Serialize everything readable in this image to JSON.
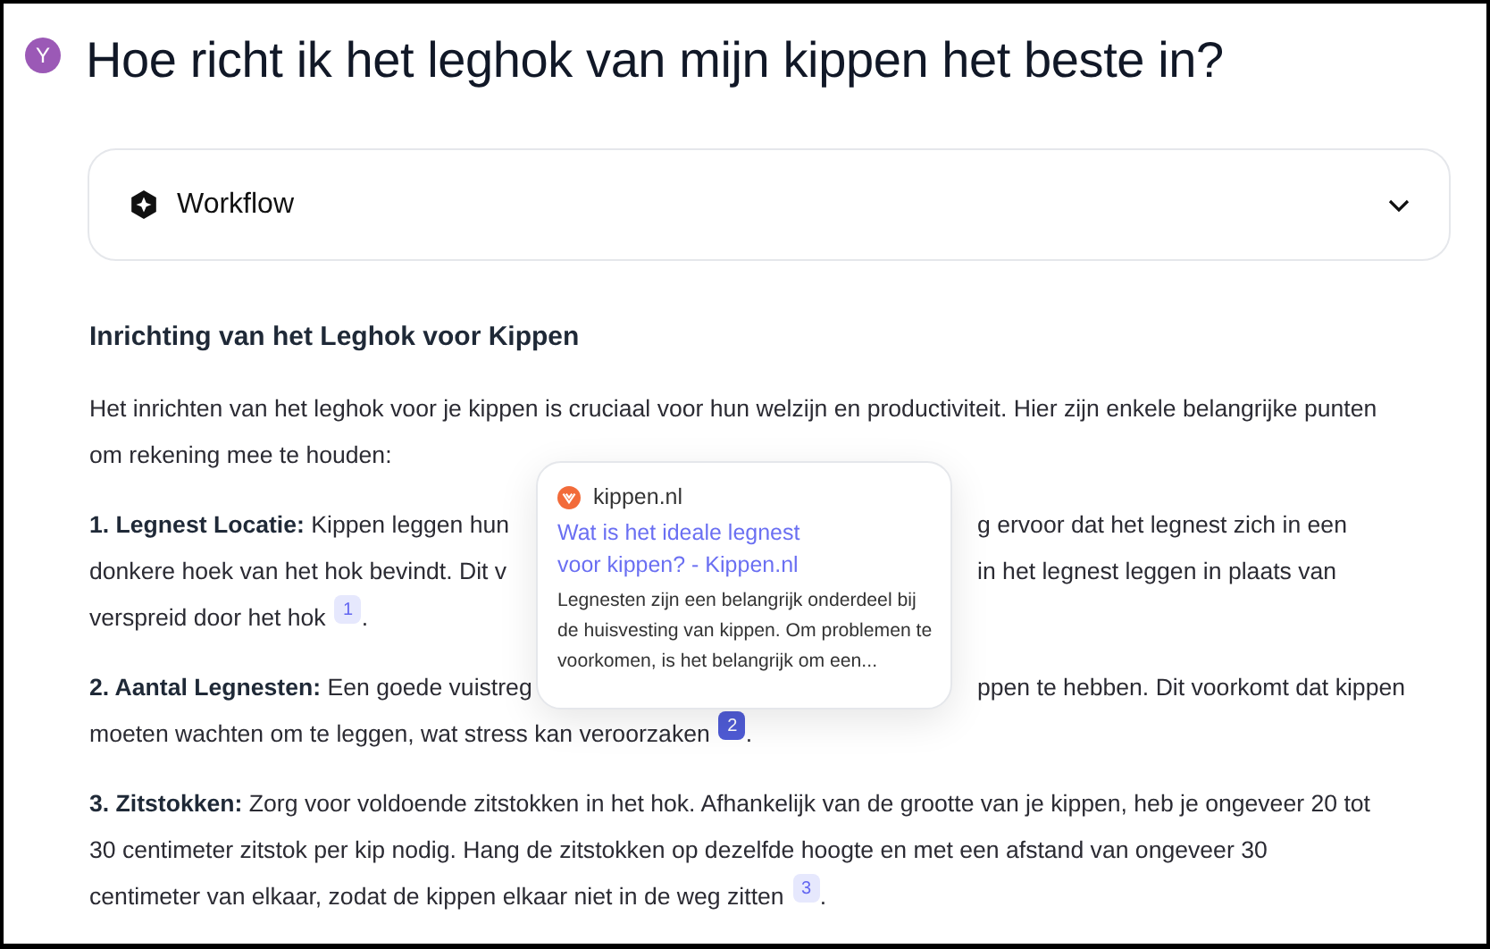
{
  "question": {
    "avatar": "Y",
    "title": "Hoe richt ik het leghok van mijn kippen het beste in?"
  },
  "workflow": {
    "label": "Workflow",
    "expanded": false
  },
  "answer": {
    "heading": "Inrichting van het Leghok voor Kippen",
    "intro": [
      "Het inrichten van het leghok voor je kippen is cruciaal voor hun welzijn en productiviteit. Hier zijn enkele belangrijke punten",
      "om rekening mee te houden:"
    ],
    "items": [
      {
        "lines": [
          {
            "left": "**1. Legnest Locatie:** Kippen leggen hun",
            "right": "g ervoor dat het legnest zich in een"
          },
          {
            "left": "donkere hoek van het hok bevindt. Dit v",
            "right": "in het legnest leggen in plaats van"
          },
          {
            "left": "verspreid door het hok",
            "cite": {
              "label": "1",
              "selected": false
            },
            "after": "."
          }
        ]
      },
      {
        "lines": [
          {
            "left": "**2. Aantal Legnesten:** Een goede vuistreg",
            "right": "ppen te hebben. Dit voorkomt dat kippen"
          },
          {
            "left": "moeten wachten om te leggen, wat stress kan veroorzaken",
            "cite": {
              "label": "2",
              "selected": true
            },
            "after": "."
          }
        ]
      },
      {
        "lines": [
          {
            "left": "**3. Zitstokken:** Zorg voor voldoende zitstokken in het hok. Afhankelijk van de grootte van je kippen, heb je ongeveer 20 tot"
          },
          {
            "left": "30 centimeter zitstok per kip nodig. Hang de zitstokken op dezelfde hoogte en met een afstand van ongeveer 30"
          },
          {
            "left": "centimeter van elkaar, zodat de kippen elkaar niet in de weg zitten",
            "cite": {
              "label": "3",
              "selected": false
            },
            "after": "."
          }
        ]
      }
    ]
  },
  "source_popup": {
    "site": "kippen.nl",
    "title": [
      "Wat is het ideale legnest",
      "voor kippen? - Kippen.nl"
    ],
    "snippet": "Legnesten zijn een belangrijk onderdeel bij de huisvesting van kippen. Om problemen te voorkomen, is het belangrijk om een..."
  }
}
